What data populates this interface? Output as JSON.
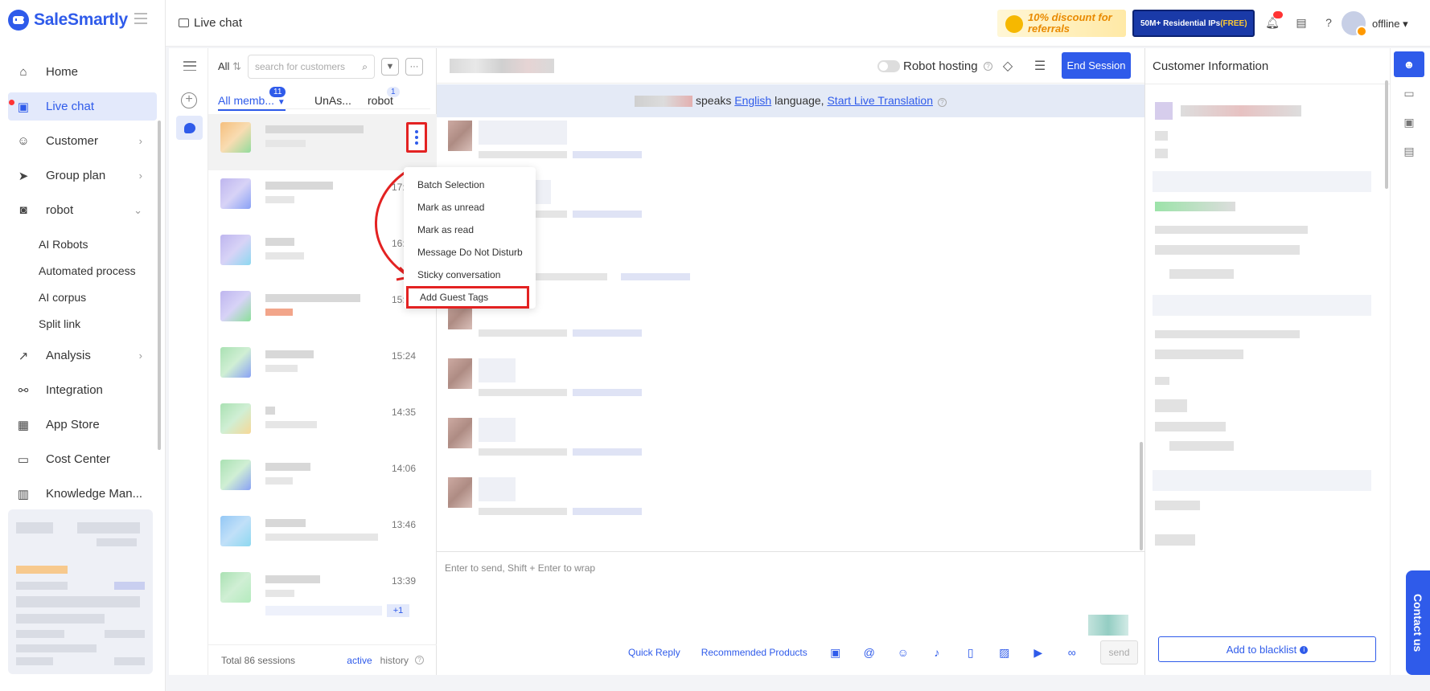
{
  "app": {
    "brand": "SaleSmartly",
    "accent": "#2f5bea"
  },
  "topbar": {
    "title": "Live chat",
    "promo1": "10% discount for referrals",
    "promo2_main": "50M+ Residential IPs",
    "promo2_free": "(FREE)",
    "status": "offline"
  },
  "nav": {
    "home": "Home",
    "live_chat": "Live chat",
    "customer": "Customer",
    "group_plan": "Group plan",
    "robot": "robot",
    "ai_robots": "AI Robots",
    "automated_process": "Automated process",
    "ai_corpus": "AI corpus",
    "split_link": "Split link",
    "analysis": "Analysis",
    "integration": "Integration",
    "app_store": "App Store",
    "cost_center": "Cost Center",
    "knowledge": "Knowledge Man..."
  },
  "sessions": {
    "filter_all": "All",
    "search_placeholder": "search for customers",
    "tabs": [
      {
        "label": "All memb...",
        "badge": "11"
      },
      {
        "label": "UnAs..."
      },
      {
        "label": "robot",
        "badge": "1"
      }
    ],
    "times": [
      "17:",
      "16:",
      "15:45",
      "15:24",
      "14:35",
      "14:06",
      "13:46",
      "13:39"
    ],
    "extra_badge": "+1",
    "total": "Total 86 sessions",
    "active": "active",
    "history": "history"
  },
  "context_menu": {
    "items": [
      "Batch Selection",
      "Mark as unread",
      "Mark as read",
      "Message Do Not Disturb",
      "Sticky conversation",
      "Add Guest Tags"
    ]
  },
  "chat": {
    "robot_hosting": "Robot hosting",
    "end_session": "End Session",
    "lang_speaks": "speaks",
    "lang_name": "English",
    "lang_word": "language,",
    "lang_link": "Start Live Translation",
    "composer_placeholder": "Enter to send, Shift + Enter to wrap",
    "quick_reply": "Quick Reply",
    "recommended": "Recommended Products",
    "send": "send"
  },
  "info": {
    "title": "Customer Information",
    "blacklist": "Add to blacklist"
  },
  "contact": "Contact us"
}
